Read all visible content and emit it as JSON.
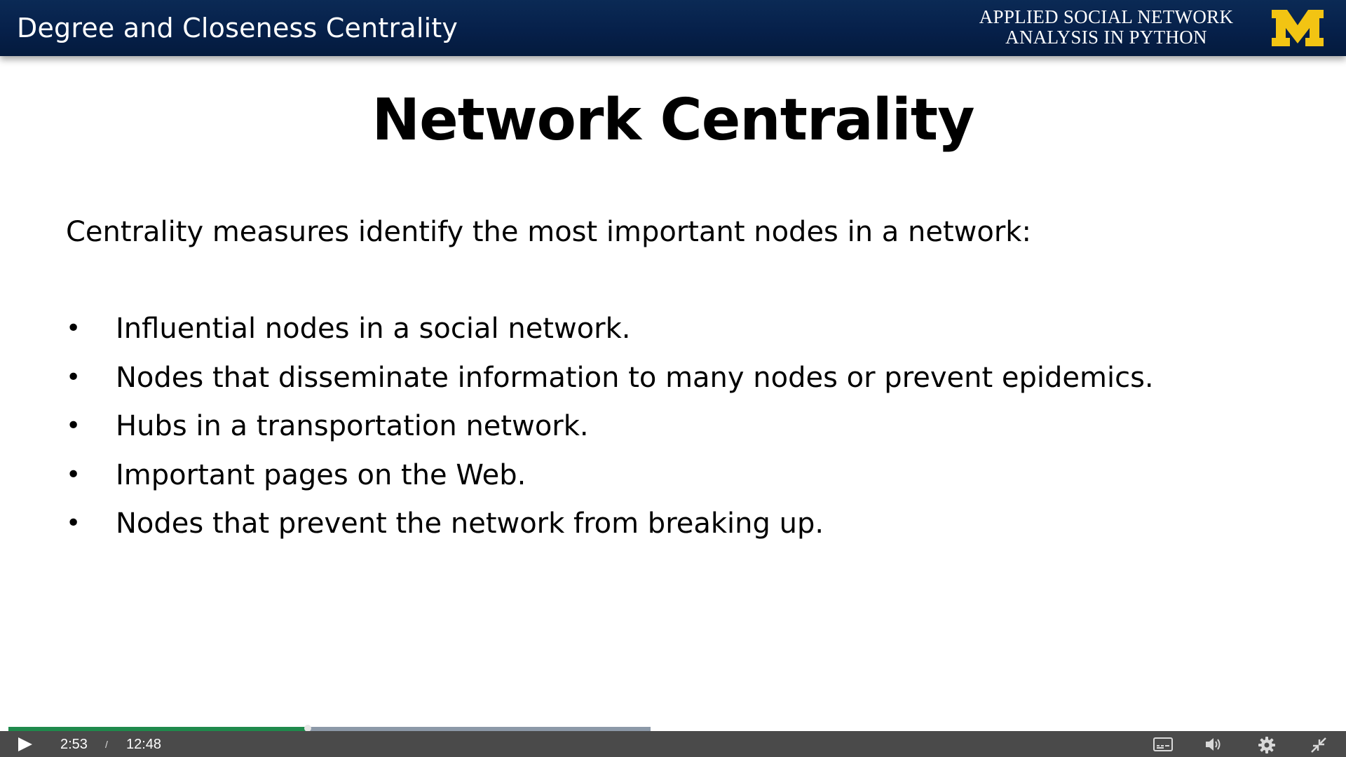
{
  "header": {
    "lecture_title": "Degree and Closeness Centrality",
    "course_title_line1": "APPLIED SOCIAL NETWORK",
    "course_title_line2": "ANALYSIS IN PYTHON",
    "logo_letter": "M",
    "logo_color": "#f2c413",
    "background_color": "#06204a"
  },
  "slide": {
    "heading": "Network Centrality",
    "intro": "Centrality measures identify the most important nodes in a network:",
    "bullet_symbol": "•",
    "bullets": [
      "Influential nodes in a social network.",
      "Nodes that disseminate information to many nodes or prevent epidemics.",
      "Hubs in a transportation network.",
      "Important pages on the Web.",
      "Nodes that prevent the network from breaking up."
    ]
  },
  "player": {
    "current_time": "2:53",
    "separator": "/",
    "total_time": "12:48",
    "played_fraction": 0.2253,
    "buffered_fraction": 0.483,
    "played_color": "#1f8a4c",
    "controls_background": "#4a4a4a",
    "icons": [
      "play-icon",
      "captions-icon",
      "volume-icon",
      "settings-gear-icon",
      "exit-fullscreen-icon"
    ]
  }
}
